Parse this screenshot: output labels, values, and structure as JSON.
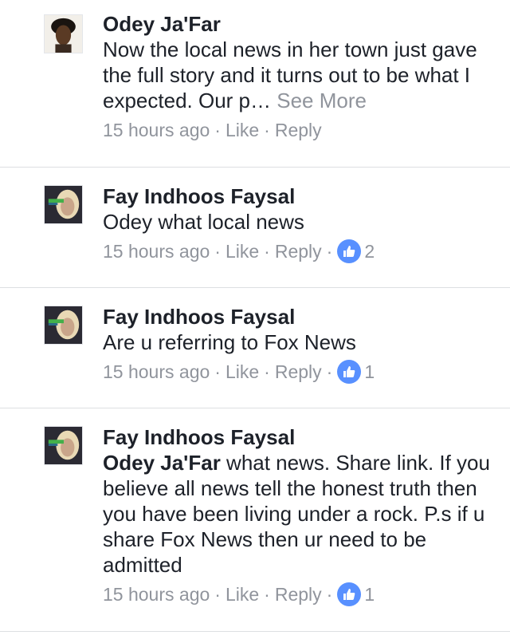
{
  "comments": [
    {
      "author": "Odey Ja'Far",
      "text": "Now the local news in her town just gave the full story and it turns out to be what I expected. Our p…",
      "see_more": "See More",
      "time": "15 hours ago",
      "like_label": "Like",
      "reply_label": "Reply",
      "separator": "·"
    },
    {
      "author": "Fay Indhoos Faysal",
      "text": "Odey what local news",
      "time": "15 hours ago",
      "like_label": "Like",
      "reply_label": "Reply",
      "separator": "·",
      "likes": "2"
    },
    {
      "author": "Fay Indhoos Faysal",
      "text": "Are u referring to Fox News",
      "time": "15 hours ago",
      "like_label": "Like",
      "reply_label": "Reply",
      "separator": "·",
      "likes": "1"
    },
    {
      "author": "Fay Indhoos Faysal",
      "mention": "Odey Ja'Far",
      "text": " what news. Share link. If you believe all news tell the honest truth then you have been living under a rock. P.s if u share Fox News then ur need to be admitted",
      "time": "15 hours ago",
      "like_label": "Like",
      "reply_label": "Reply",
      "separator": "·",
      "likes": "1"
    }
  ],
  "colors": {
    "meta": "#90949c",
    "like_badge": "#5890ff",
    "divider": "#dddfe2"
  },
  "icons": {
    "like": "thumbs-up-icon"
  }
}
